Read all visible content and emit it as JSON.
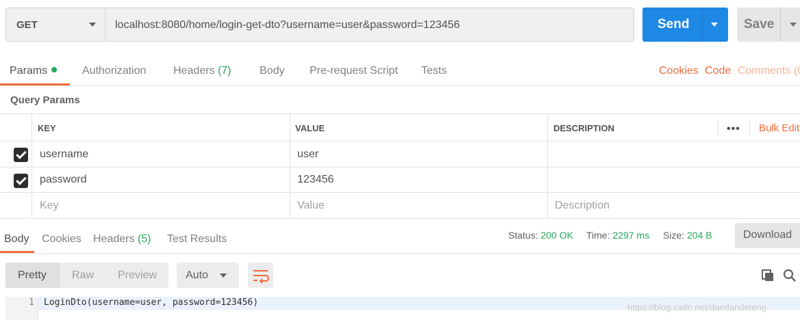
{
  "request": {
    "method": "GET",
    "url": "localhost:8080/home/login-get-dto?username=user&password=123456",
    "send_label": "Send",
    "save_label": "Save"
  },
  "request_tabs": {
    "params": "Params",
    "authorization": "Authorization",
    "headers": "Headers",
    "headers_count": "(7)",
    "body": "Body",
    "prerequest": "Pre-request Script",
    "tests": "Tests",
    "cookies": "Cookies",
    "code": "Code",
    "comments": "Comments (0"
  },
  "query_params": {
    "title": "Query Params",
    "columns": {
      "key": "KEY",
      "value": "VALUE",
      "description": "DESCRIPTION"
    },
    "more": "•••",
    "bulk_edit": "Bulk Edit",
    "rows": [
      {
        "checked": true,
        "key": "username",
        "value": "user",
        "description": ""
      },
      {
        "checked": true,
        "key": "password",
        "value": "123456",
        "description": ""
      }
    ],
    "placeholders": {
      "key": "Key",
      "value": "Value",
      "description": "Description"
    }
  },
  "response_tabs": {
    "body": "Body",
    "cookies": "Cookies",
    "headers": "Headers",
    "headers_count": "(5)",
    "test_results": "Test Results"
  },
  "response_status": {
    "status_label": "Status:",
    "status_value": "200 OK",
    "time_label": "Time:",
    "time_value": "2297 ms",
    "size_label": "Size:",
    "size_value": "204 B",
    "download_label": "Download"
  },
  "view_modes": {
    "pretty": "Pretty",
    "raw": "Raw",
    "preview": "Preview",
    "format": "Auto"
  },
  "response_body": {
    "line_number": "1",
    "line": "LoginDto(username=user, password=123456)"
  },
  "watermark": "https://blog.csdn.net/dandandeteng",
  "colors": {
    "accent": "#f26b3a",
    "send": "#1e88e5",
    "success": "#26a65b"
  }
}
